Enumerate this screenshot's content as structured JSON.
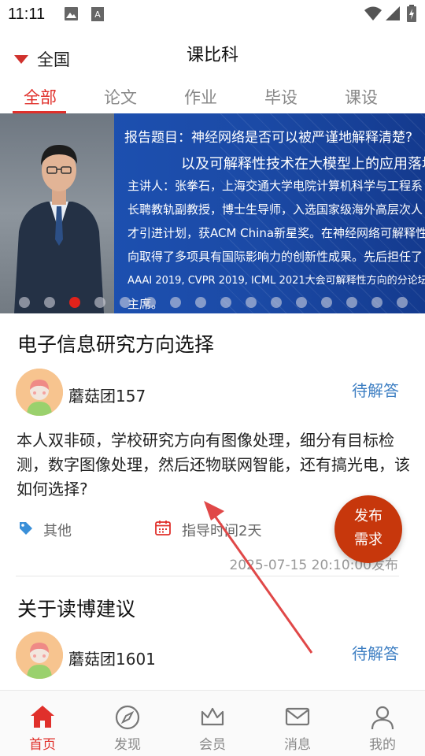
{
  "status_bar": {
    "time": "11:11",
    "icons": [
      "image-icon",
      "a-box-icon",
      "wifi-icon",
      "signal-icon",
      "battery-charging-icon"
    ]
  },
  "header": {
    "region_label": "全国",
    "title": "课比科"
  },
  "tabs": [
    {
      "label": "全部",
      "active": true
    },
    {
      "label": "论文",
      "active": false
    },
    {
      "label": "作业",
      "active": false
    },
    {
      "label": "毕设",
      "active": false
    },
    {
      "label": "课设",
      "active": false
    }
  ],
  "banner": {
    "lines": [
      "报告题目：神经网络是否可以被严谨地解释清楚?",
      "以及可解释性技术在大模型上的应用落地",
      "主讲人：张拳石，上海交通大学电院计算机科学与工程系",
      "长聘教轨副教授，博士生导师，入选国家级海外高层次人",
      "才引进计划，获ACM China新星奖。在神经网络可解释性方",
      "向取得了多项具有国际影响力的创新性成果。先后担任了",
      "AAAI 2019, CVPR 2019, ICML 2021大会可解释性方向的分论坛",
      "主席。"
    ],
    "slide_count": 16,
    "active_slide": 3
  },
  "questions": [
    {
      "title": "电子信息研究方向选择",
      "user": "蘑菇团157",
      "status": "待解答",
      "body": "本人双非硕，学校研究方向有图像处理，细分有目标检测，数字图像处理，然后还物联网智能，还有搞光电，该如何选择?",
      "tag": "其他",
      "duration": "指导时间2天",
      "posted": "2025-07-15 20:10:00发布"
    },
    {
      "title": "关于读博建议",
      "user": "蘑菇团1601",
      "status": "待解答"
    }
  ],
  "fab": {
    "line1": "发布",
    "line2": "需求"
  },
  "bottom_nav": [
    {
      "label": "首页",
      "icon": "home-icon",
      "active": true
    },
    {
      "label": "发现",
      "icon": "compass-icon",
      "active": false
    },
    {
      "label": "会员",
      "icon": "crown-icon",
      "active": false
    },
    {
      "label": "消息",
      "icon": "mail-icon",
      "active": false
    },
    {
      "label": "我的",
      "icon": "person-icon",
      "active": false
    }
  ],
  "colors": {
    "accent": "#e0302b",
    "status_blue": "#3e7fc3",
    "fab": "#c7370c",
    "banner_blue": "#1e54b7"
  }
}
